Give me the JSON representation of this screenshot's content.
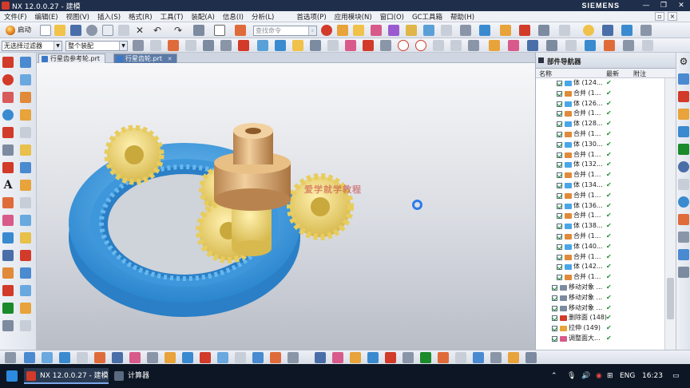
{
  "window": {
    "title": "NX 12.0.0.27 - 建模",
    "brand": "SIEMENS"
  },
  "menu": [
    "文件(F)",
    "编辑(E)",
    "视图(V)",
    "插入(S)",
    "格式(R)",
    "工具(T)",
    "装配(A)",
    "信息(I)",
    "分析(L)",
    "首选项(P)",
    "应用模块(N)",
    "窗口(O)",
    "GC工具箱",
    "帮助(H)"
  ],
  "toolbar": {
    "start_label": "启动",
    "search_placeholder": "查找命令",
    "filter_value": "无选择过滤器",
    "assembly_value": "整个装配"
  },
  "tabs": [
    {
      "label": "行星齿参考轮.prt",
      "active": false
    },
    {
      "label": "行星齿轮.prt",
      "active": true
    }
  ],
  "watermark": "爱学就学教程",
  "navigator": {
    "title": "部件导航器",
    "columns": {
      "name": "名称",
      "latest": "最新",
      "note": "附注"
    },
    "rows": [
      {
        "label": "体 (124...",
        "type": "body",
        "check": "✔"
      },
      {
        "label": "合并 (1...",
        "type": "merge",
        "check": "✔"
      },
      {
        "label": "体 (126...",
        "type": "body",
        "check": "✔"
      },
      {
        "label": "合并 (1...",
        "type": "merge",
        "check": "✔"
      },
      {
        "label": "体 (128...",
        "type": "body",
        "check": "✔"
      },
      {
        "label": "合并 (1...",
        "type": "merge",
        "check": "✔"
      },
      {
        "label": "体 (130...",
        "type": "body",
        "check": "✔"
      },
      {
        "label": "合并 (1...",
        "type": "merge",
        "check": "✔"
      },
      {
        "label": "体 (132...",
        "type": "body",
        "check": "✔"
      },
      {
        "label": "合并 (1...",
        "type": "merge",
        "check": "✔"
      },
      {
        "label": "体 (134...",
        "type": "body",
        "check": "✔"
      },
      {
        "label": "合并 (1...",
        "type": "merge",
        "check": "✔"
      },
      {
        "label": "体 (136...",
        "type": "body",
        "check": "✔"
      },
      {
        "label": "合并 (1...",
        "type": "merge",
        "check": "✔"
      },
      {
        "label": "体 (138...",
        "type": "body",
        "check": "✔"
      },
      {
        "label": "合并 (1...",
        "type": "merge",
        "check": "✔"
      },
      {
        "label": "体 (140...",
        "type": "body",
        "check": "✔"
      },
      {
        "label": "合并 (1...",
        "type": "merge",
        "check": "✔"
      },
      {
        "label": "体 (142...",
        "type": "body",
        "check": "✔"
      },
      {
        "label": "合并 (1...",
        "type": "merge",
        "check": "✔"
      },
      {
        "label": "移动对象 ...",
        "type": "move",
        "check": "✔"
      },
      {
        "label": "移动对象 ...",
        "type": "move",
        "check": "✔"
      },
      {
        "label": "移动对象 ...",
        "type": "move",
        "check": "✔"
      },
      {
        "label": "删除面 (148)",
        "type": "delete",
        "check": "✔"
      },
      {
        "label": "拉伸 (149)",
        "type": "extrude",
        "check": "✔"
      },
      {
        "label": "调整面大...",
        "type": "resize",
        "check": "✔"
      }
    ]
  },
  "taskbar": {
    "items": [
      {
        "label": "NX 12.0.0.27 - 建模",
        "active": true
      },
      {
        "label": "计算器",
        "active": false
      }
    ],
    "lang": "ENG",
    "time": "16:23"
  },
  "colors": {
    "ring_gear": "#4aa6e8",
    "planet_gear": "#f0d877",
    "shaft": "#e2b47e",
    "title_bar": "#1f2e4a"
  }
}
